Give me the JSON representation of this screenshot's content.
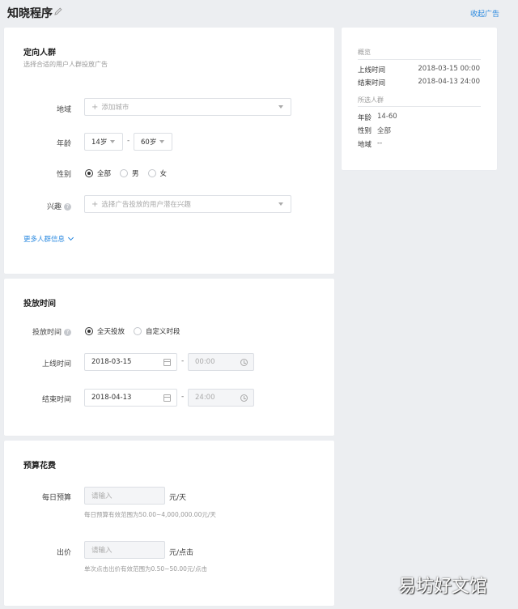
{
  "header": {
    "title": "知晓程序",
    "collapse_link": "收起广告"
  },
  "targeting": {
    "title": "定向人群",
    "subtitle": "选择合适的用户人群投放广告",
    "region": {
      "label": "地域",
      "placeholder": "添加城市"
    },
    "age": {
      "label": "年龄",
      "min": "14岁",
      "max": "60岁",
      "separator": "-"
    },
    "gender": {
      "label": "性别",
      "options": [
        "全部",
        "男",
        "女"
      ],
      "selected": "全部"
    },
    "interest": {
      "label": "兴趣",
      "placeholder": "选择广告投放的用户潜在兴趣"
    },
    "more_link": "更多人群信息"
  },
  "schedule": {
    "title": "投放时间",
    "mode": {
      "label": "投放时间",
      "options": [
        "全天投放",
        "自定义时段"
      ],
      "selected": "全天投放"
    },
    "start": {
      "label": "上线时间",
      "date": "2018-03-15",
      "time": "00:00"
    },
    "end": {
      "label": "结束时间",
      "date": "2018-04-13",
      "time": "24:00"
    },
    "separator": "-"
  },
  "budget": {
    "title": "预算花费",
    "daily": {
      "label": "每日预算",
      "placeholder": "请输入",
      "unit": "元/天",
      "hint": "每日预算有效范围为50.00~4,000,000.00元/天"
    },
    "bid": {
      "label": "出价",
      "placeholder": "请输入",
      "unit": "元/点击",
      "hint": "单次点击出价有效范围为0.50~50.00元/点击"
    }
  },
  "overview": {
    "title": "概览",
    "start_label": "上线时间",
    "start_value": "2018-03-15 00:00",
    "end_label": "结束时间",
    "end_value": "2018-04-13 24:00",
    "audience_title": "所选人群",
    "age_label": "年龄",
    "age_value": "14-60",
    "gender_label": "性别",
    "gender_value": "全部",
    "region_label": "地域",
    "region_value": "--"
  },
  "watermark": "易坊好文馆",
  "colors": {
    "accent": "#2b8ae0",
    "background": "#eceef1",
    "card": "#ffffff"
  }
}
